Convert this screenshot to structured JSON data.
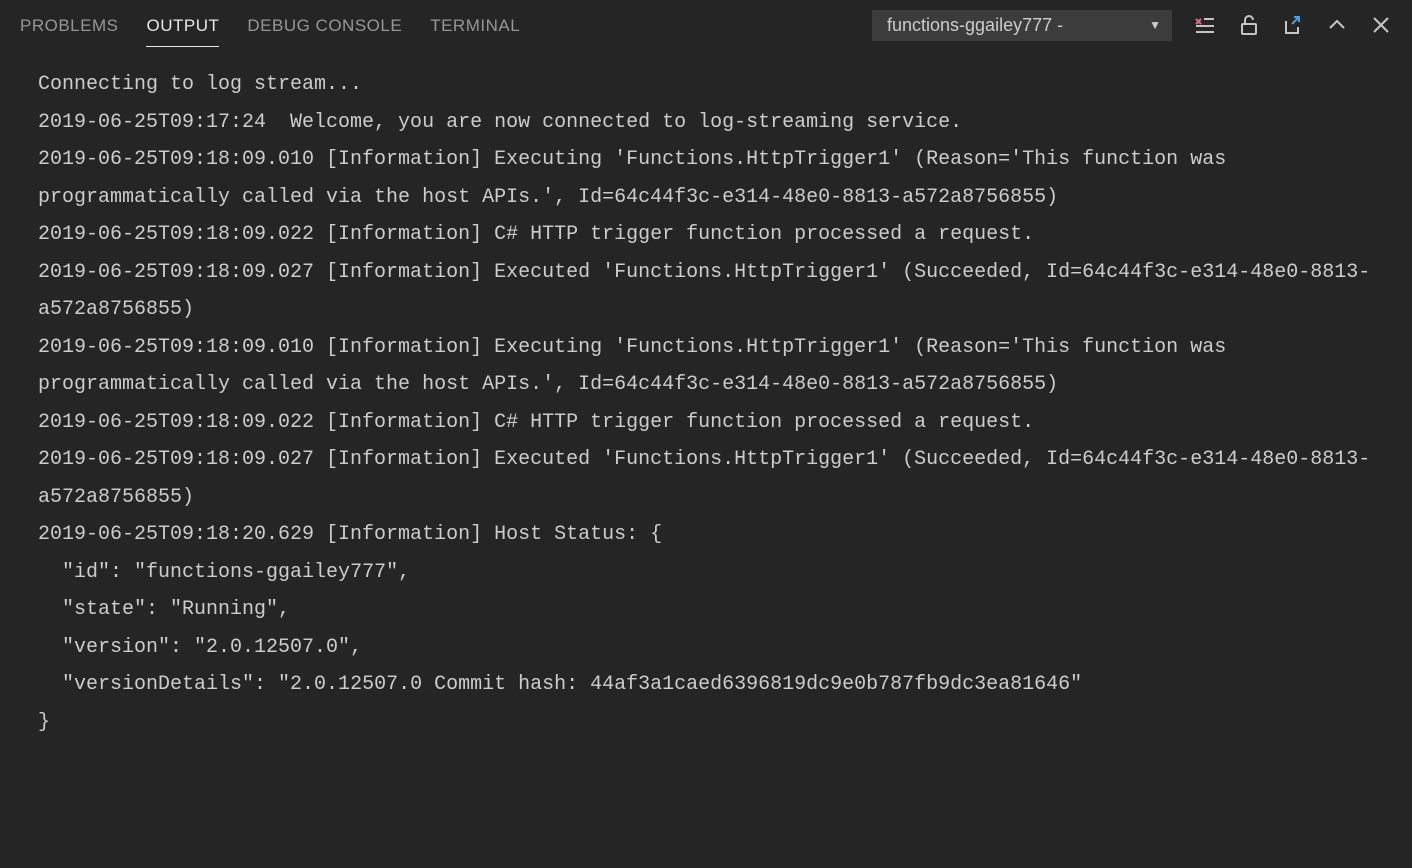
{
  "tabs": {
    "problems": "PROBLEMS",
    "output": "OUTPUT",
    "debugConsole": "DEBUG CONSOLE",
    "terminal": "TERMINAL"
  },
  "dropdown": {
    "selected": "functions-ggailey777 -"
  },
  "output": {
    "lines": [
      "Connecting to log stream...",
      "2019-06-25T09:17:24  Welcome, you are now connected to log-streaming service.",
      "2019-06-25T09:18:09.010 [Information] Executing 'Functions.HttpTrigger1' (Reason='This function was programmatically called via the host APIs.', Id=64c44f3c-e314-48e0-8813-a572a8756855)",
      "2019-06-25T09:18:09.022 [Information] C# HTTP trigger function processed a request.",
      "2019-06-25T09:18:09.027 [Information] Executed 'Functions.HttpTrigger1' (Succeeded, Id=64c44f3c-e314-48e0-8813-a572a8756855)",
      "2019-06-25T09:18:09.010 [Information] Executing 'Functions.HttpTrigger1' (Reason='This function was programmatically called via the host APIs.', Id=64c44f3c-e314-48e0-8813-a572a8756855)",
      "2019-06-25T09:18:09.022 [Information] C# HTTP trigger function processed a request.",
      "2019-06-25T09:18:09.027 [Information] Executed 'Functions.HttpTrigger1' (Succeeded, Id=64c44f3c-e314-48e0-8813-a572a8756855)",
      "2019-06-25T09:18:20.629 [Information] Host Status: {",
      "  \"id\": \"functions-ggailey777\",",
      "  \"state\": \"Running\",",
      "  \"version\": \"2.0.12507.0\",",
      "  \"versionDetails\": \"2.0.12507.0 Commit hash: 44af3a1caed6396819dc9e0b787fb9dc3ea81646\"",
      "}"
    ]
  }
}
